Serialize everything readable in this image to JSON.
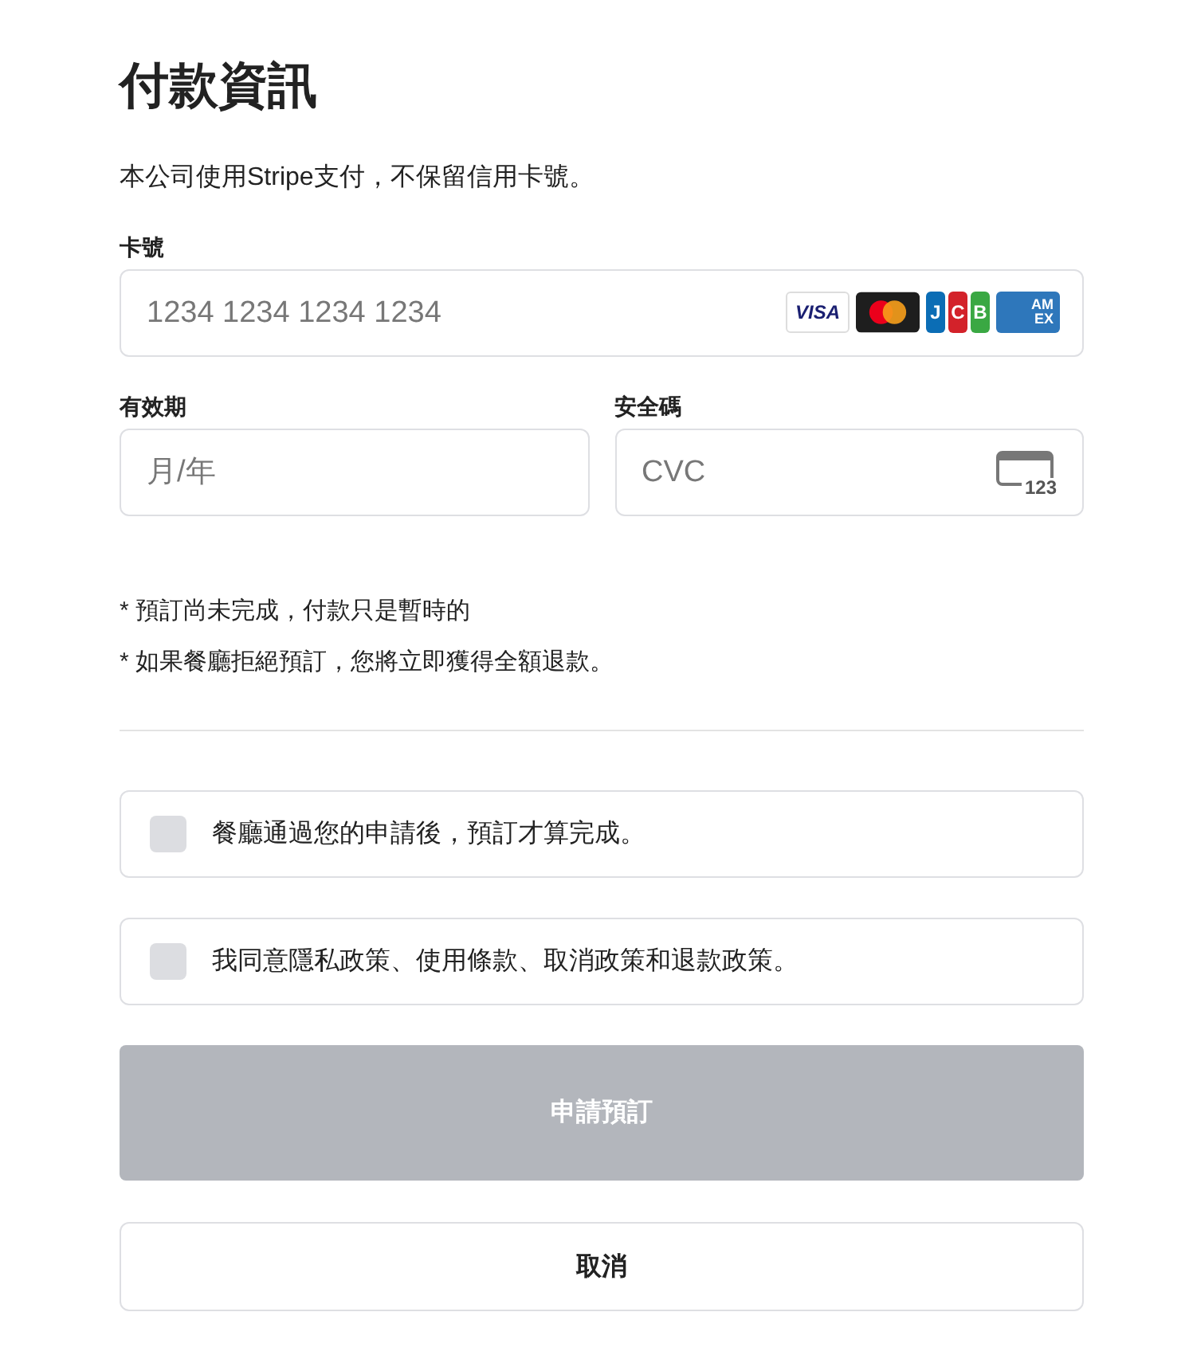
{
  "title": "付款資訊",
  "intro": "本公司使用Stripe支付，不保留信用卡號。",
  "card_number": {
    "label": "卡號",
    "placeholder": "1234 1234 1234 1234",
    "brands": [
      {
        "kind": "visa",
        "letters": [
          "VISA"
        ]
      },
      {
        "kind": "mastercard"
      },
      {
        "kind": "jcb",
        "letters": [
          "J",
          "C",
          "B"
        ]
      },
      {
        "kind": "amex",
        "letters": [
          "AM",
          "EX"
        ]
      }
    ]
  },
  "expiry": {
    "label": "有效期",
    "placeholder": "月/年"
  },
  "cvc": {
    "label": "安全碼",
    "placeholder": "CVC",
    "icon_text": "123"
  },
  "notes": [
    "* 預訂尚未完成，付款只是暫時的",
    "* 如果餐廳拒絕預訂，您將立即獲得全額退款。"
  ],
  "agreements": [
    {
      "label": "餐廳通過您的申請後，預訂才算完成。",
      "checked": false
    },
    {
      "label": "我同意隱私政策、使用條款、取消政策和退款政策。",
      "checked": false
    }
  ],
  "submit": {
    "label": "申請預訂",
    "disabled": true
  },
  "cancel": {
    "label": "取消"
  }
}
